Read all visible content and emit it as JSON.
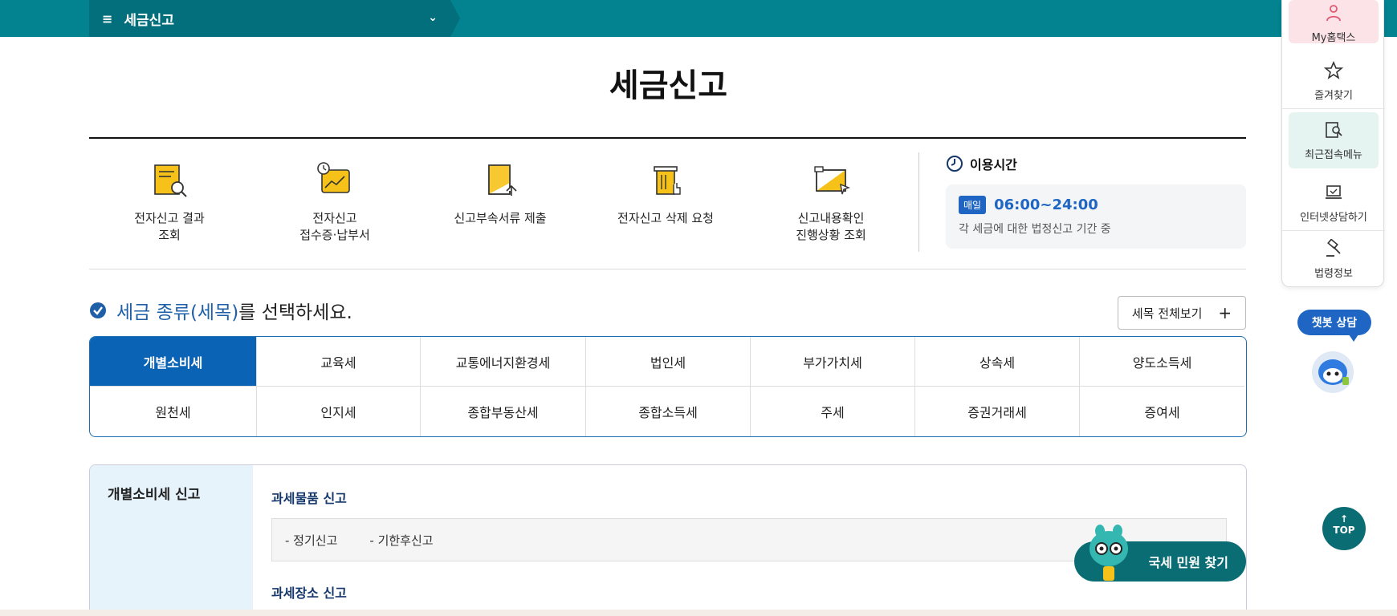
{
  "nav": {
    "breadcrumb": "세금신고"
  },
  "page": {
    "title": "세금신고"
  },
  "services": [
    {
      "label_line1": "전자신고 결과",
      "label_line2": "조회",
      "icon": "document-search-icon"
    },
    {
      "label_line1": "전자신고",
      "label_line2": "접수증·납부서",
      "icon": "receipt-clock-icon"
    },
    {
      "label_line1": "신고부속서류 제출",
      "label_line2": "",
      "icon": "document-upload-icon"
    },
    {
      "label_line1": "전자신고 삭제 요청",
      "label_line2": "",
      "icon": "trash-click-icon"
    },
    {
      "label_line1": "신고내용확인",
      "label_line2": "진행상황 조회",
      "icon": "folder-cursor-icon"
    }
  ],
  "hours": {
    "title": "이용시간",
    "badge": "매일",
    "time": "06:00~24:00",
    "note": "각 세금에 대한 법정신고 기간 중"
  },
  "select": {
    "highlight": "세금 종류(세목)",
    "rest": "를 선택하세요.",
    "view_all": "세목 전체보기",
    "plus": "+"
  },
  "tax_types": [
    "개별소비세",
    "교육세",
    "교통에너지환경세",
    "법인세",
    "부가가치세",
    "상속세",
    "양도소득세",
    "원천세",
    "인지세",
    "종합부동산세",
    "종합소득세",
    "주세",
    "증권거래세",
    "증여세"
  ],
  "panel": {
    "side_title": "개별소비세 신고",
    "section1": "과세물품 신고",
    "links": [
      "- 정기신고",
      "- 기한후신고"
    ],
    "section2": "과세장소 신고"
  },
  "quick_menu": {
    "my": "My홈택스",
    "favorites": "즐겨찾기",
    "recent": "최근접속메뉴",
    "consult": "인터넷상담하기",
    "law": "법령정보"
  },
  "chatbot": {
    "label": "챗봇 상담"
  },
  "top_button": {
    "arrow": "↑",
    "label": "TOP"
  },
  "civil": {
    "label": "국세 민원 찾기"
  },
  "colors": {
    "teal": "#03828f",
    "blue": "#0b63b6",
    "accent": "#1f66c4"
  }
}
